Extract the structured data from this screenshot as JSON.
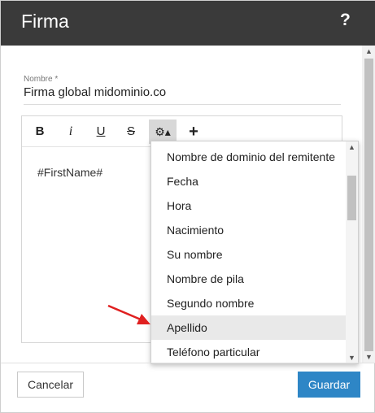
{
  "dialog": {
    "title": "Firma",
    "help_label": "?"
  },
  "form": {
    "name_label": "Nombre *",
    "name_value": "Firma global midominio.co"
  },
  "toolbar": {
    "bold": "B",
    "italic": "i",
    "underline": "U",
    "strike": "S",
    "gear": "⚙▴",
    "plus": "+"
  },
  "editor": {
    "content": "#FirstName#"
  },
  "dropdown": {
    "items": [
      "Nombre de dominio del remitente",
      "Fecha",
      "Hora",
      "Nacimiento",
      "Su nombre",
      "Nombre de pila",
      "Segundo nombre",
      "Apellido",
      "Teléfono particular"
    ],
    "highlighted": "Apellido"
  },
  "footer": {
    "cancel_label": "Cancelar",
    "save_label": "Guardar"
  },
  "colors": {
    "titlebar": "#3a3a3a",
    "primary": "#2e86c6",
    "pointer_arrow": "#e02020"
  },
  "icons": {
    "help": "question-mark-icon",
    "gear": "gear-icon",
    "plus": "plus-icon",
    "pointer": "red-arrow-icon"
  }
}
